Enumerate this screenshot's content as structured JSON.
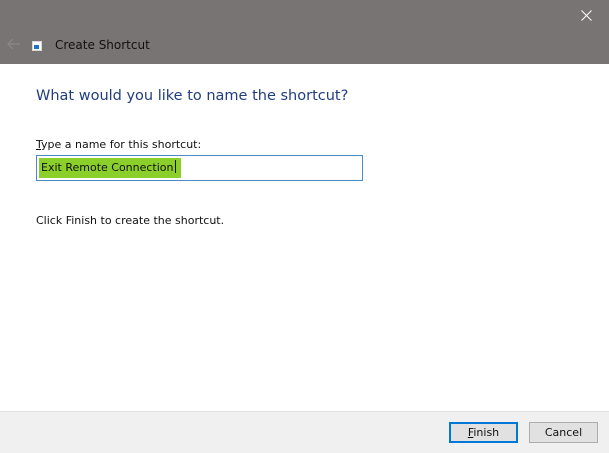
{
  "window": {
    "title": "Create Shortcut"
  },
  "content": {
    "heading": "What would you like to name the shortcut?",
    "field_label_first": "T",
    "field_label_rest": "ype a name for this shortcut:",
    "name_value": "Exit Remote Connection",
    "info": "Click Finish to create the shortcut."
  },
  "footer": {
    "finish_first": "F",
    "finish_rest": "inish",
    "cancel_label": "Cancel"
  },
  "colors": {
    "titlebar": "#797474",
    "heading": "#1f3d80",
    "selection_highlight": "#8bcf2a",
    "input_border": "#4a8ac9",
    "default_button_border": "#0078d7"
  },
  "icons": {
    "close": "close-icon",
    "back": "back-arrow-icon",
    "app": "shortcut-app-icon"
  }
}
